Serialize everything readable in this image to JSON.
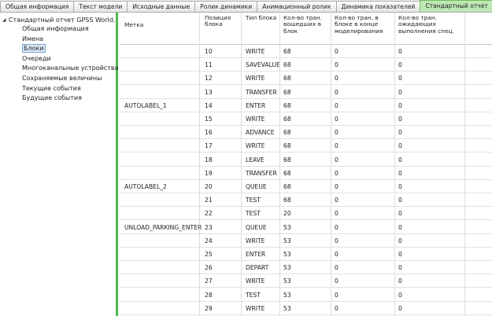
{
  "tabs": [
    {
      "label": "Общая информация",
      "active": false
    },
    {
      "label": "Текст модели",
      "active": false
    },
    {
      "label": "Исходные данные",
      "active": false
    },
    {
      "label": "Ролик динамики",
      "active": false
    },
    {
      "label": "Анимационный ролик",
      "active": false
    },
    {
      "label": "Динамика показателей",
      "active": false
    },
    {
      "label": "Стандартный отчет",
      "active": true
    }
  ],
  "tree": {
    "root": "Стандартный отчет GPSS World.",
    "items": [
      {
        "label": "Общая информация",
        "selected": false
      },
      {
        "label": "Имена",
        "selected": false
      },
      {
        "label": "Блоки",
        "selected": true
      },
      {
        "label": "Очереди",
        "selected": false
      },
      {
        "label": "Многоканальные устройства",
        "selected": false
      },
      {
        "label": "Сохраняемые величины",
        "selected": false
      },
      {
        "label": "Текущие события",
        "selected": false
      },
      {
        "label": "Будущие события",
        "selected": false
      }
    ]
  },
  "table": {
    "headers": [
      "Метка",
      "Позиция блока",
      "Тип блока",
      "Кол-во тран. вошедших в блок",
      "Кол-во тран. в блоке в конце моделирования",
      "Кол-во тран. ожидающих выполнения спец."
    ],
    "rows": [
      [
        "",
        "10",
        "WRITE",
        "68",
        "0",
        "0"
      ],
      [
        "",
        "11",
        "SAVEVALUE",
        "68",
        "0",
        "0"
      ],
      [
        "",
        "12",
        "WRITE",
        "68",
        "0",
        "0"
      ],
      [
        "",
        "13",
        "TRANSFER",
        "68",
        "0",
        "0"
      ],
      [
        "AUTOLABEL_1",
        "14",
        "ENTER",
        "68",
        "0",
        "0"
      ],
      [
        "",
        "15",
        "WRITE",
        "68",
        "0",
        "0"
      ],
      [
        "",
        "16",
        "ADVANCE",
        "68",
        "0",
        "0"
      ],
      [
        "",
        "17",
        "WRITE",
        "68",
        "0",
        "0"
      ],
      [
        "",
        "18",
        "LEAVE",
        "68",
        "0",
        "0"
      ],
      [
        "",
        "19",
        "TRANSFER",
        "68",
        "0",
        "0"
      ],
      [
        "AUTOLABEL_2",
        "20",
        "QUEUE",
        "68",
        "0",
        "0"
      ],
      [
        "",
        "21",
        "TEST",
        "68",
        "0",
        "0"
      ],
      [
        "",
        "22",
        "TEST",
        "20",
        "0",
        "0"
      ],
      [
        "UNLOAD_PARKING_ENTER",
        "23",
        "QUEUE",
        "53",
        "0",
        "0"
      ],
      [
        "",
        "24",
        "WRITE",
        "53",
        "0",
        "0"
      ],
      [
        "",
        "25",
        "ENTER",
        "53",
        "0",
        "0"
      ],
      [
        "",
        "26",
        "DEPART",
        "53",
        "0",
        "0"
      ],
      [
        "",
        "27",
        "WRITE",
        "53",
        "0",
        "0"
      ],
      [
        "",
        "28",
        "TEST",
        "53",
        "0",
        "0"
      ],
      [
        "",
        "29",
        "WRITE",
        "53",
        "0",
        "0"
      ]
    ]
  },
  "colors": {
    "accent_green": "#4fba4d",
    "active_tab": "#bde8b4",
    "selection": "#dce9f7"
  }
}
